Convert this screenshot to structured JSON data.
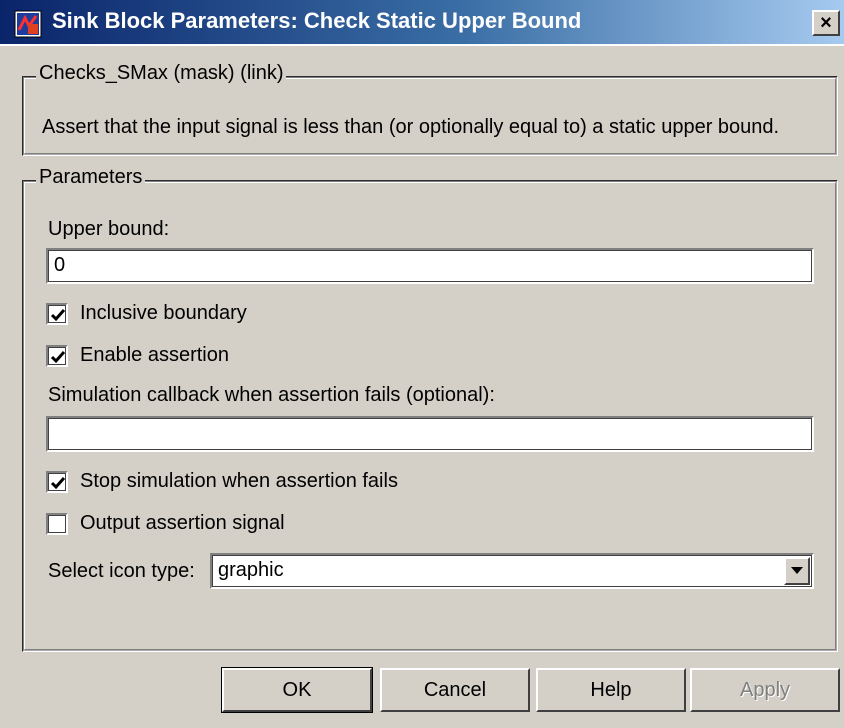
{
  "window": {
    "title": "Sink Block Parameters: Check Static  Upper Bound",
    "close_icon": "close-icon",
    "close_label": "×"
  },
  "mask_group": {
    "legend": "Checks_SMax (mask) (link)",
    "description": "Assert that the input signal is less than (or optionally equal to) a static upper bound."
  },
  "parameters": {
    "legend": "Parameters",
    "upper_bound_label": "Upper bound:",
    "upper_bound_value": "0",
    "inclusive_boundary": {
      "label": "Inclusive boundary",
      "checked": true
    },
    "enable_assertion": {
      "label": "Enable assertion",
      "checked": true
    },
    "callback_label": "Simulation callback when assertion fails (optional):",
    "callback_value": "",
    "stop_simulation": {
      "label": "Stop simulation when assertion fails",
      "checked": true
    },
    "output_signal": {
      "label": "Output assertion signal",
      "checked": false
    },
    "icon_type_label": "Select icon type:",
    "icon_type_value": "graphic"
  },
  "buttons": {
    "ok": "OK",
    "cancel": "Cancel",
    "help": "Help",
    "apply": "Apply",
    "apply_enabled": false
  },
  "colors": {
    "title_gradient_start": "#0a246a",
    "title_gradient_end": "#a6caf0",
    "dialog_bg": "#d4d0c8"
  }
}
